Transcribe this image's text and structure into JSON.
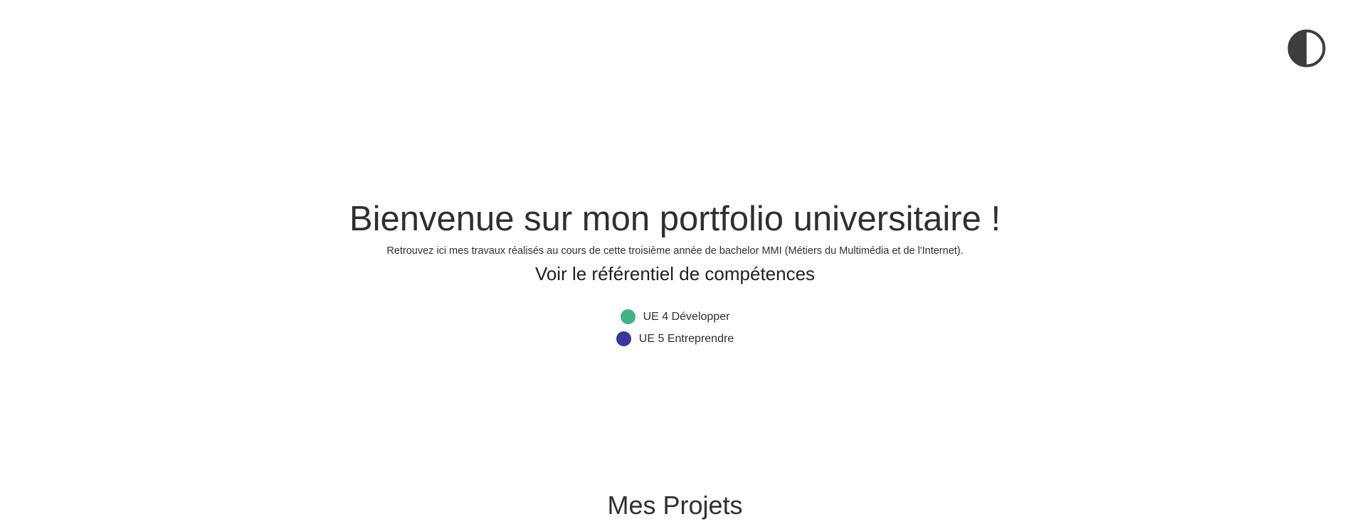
{
  "theme_toggle": {
    "icon": "half-circle-contrast-icon",
    "color": "#3d3d3d"
  },
  "hero": {
    "title": "Bienvenue sur mon portfolio universitaire !",
    "subtitle": "Retrouvez ici mes travaux réalisés au cours de cette troisième année de bachelor MMI (Métiers du Multimédia et de l'Internet).",
    "referentiel_link": "Voir le référentiel de compétences"
  },
  "legend": {
    "items": [
      {
        "label": "UE 4 Développer",
        "color": "#3fb382"
      },
      {
        "label": "UE 5 Entreprendre",
        "color": "#3b35a0"
      }
    ]
  },
  "projects": {
    "title": "Mes Projets"
  }
}
